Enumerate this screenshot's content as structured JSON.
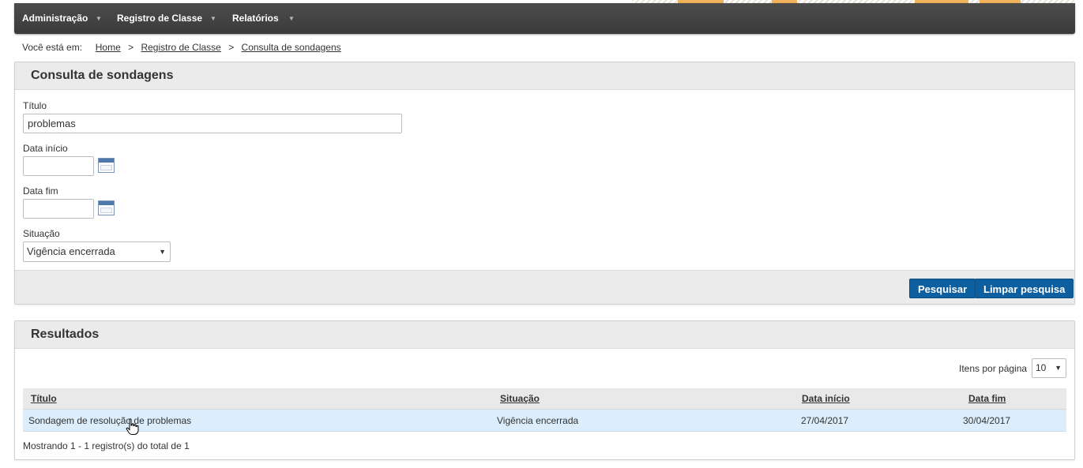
{
  "menu": {
    "items": [
      {
        "label": "Administração",
        "caret": "▼"
      },
      {
        "label": "Registro de Classe",
        "caret": "▼"
      },
      {
        "label": "Relatórios",
        "caret": "▼"
      }
    ]
  },
  "breadcrumb": {
    "prefix": "Você está em:",
    "separator": ">",
    "links": [
      "Home",
      "Registro de Classe",
      "Consulta de sondagens"
    ]
  },
  "search_panel": {
    "title": "Consulta de sondagens",
    "titulo_label": "Título",
    "titulo_value": "problemas",
    "data_inicio_label": "Data início",
    "data_inicio_value": "",
    "data_fim_label": "Data fim",
    "data_fim_value": "",
    "situacao_label": "Situação",
    "situacao_value": "Vigência encerrada",
    "calendar_icon": "calendar-icon",
    "pesquisar_button": "Pesquisar",
    "limpar_button": "Limpar pesquisa"
  },
  "results_panel": {
    "title": "Resultados",
    "items_per_page_label": "Itens por página",
    "items_per_page_value": "10",
    "columns": [
      "Título",
      "Situação",
      "Data início",
      "Data fim"
    ],
    "rows": [
      {
        "titulo": "Sondagem de resolução de problemas",
        "situacao": "Vigência encerrada",
        "data_inicio": "27/04/2017",
        "data_fim": "30/04/2017"
      }
    ],
    "summary": "Mostrando 1 - 1 registro(s) do total de 1"
  },
  "colors": {
    "menubar": "#404040",
    "primary_button": "#0e5f9f",
    "selected_row": "#dceefb",
    "accent_stripe": "#f0b25a"
  }
}
